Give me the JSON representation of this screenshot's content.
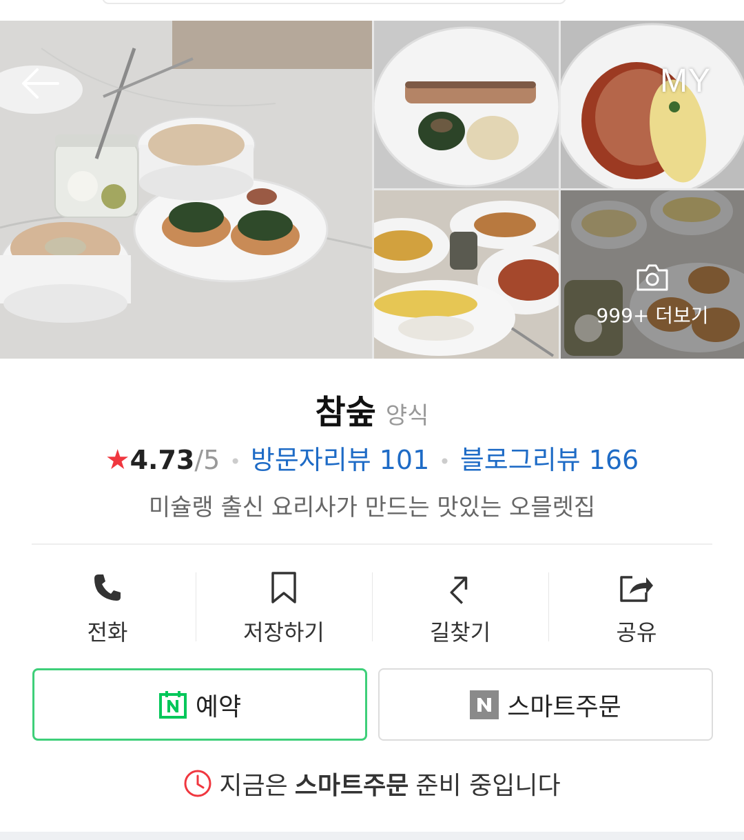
{
  "header": {
    "back_icon": "arrow-left-icon",
    "my_label": "MY"
  },
  "gallery": {
    "more_label": "999+ 더보기",
    "camera_icon": "camera-icon"
  },
  "place": {
    "name": "참숲",
    "category": "양식",
    "rating": "4.73",
    "rating_max": "/5",
    "visitor_reviews": "방문자리뷰 101",
    "blog_reviews": "블로그리뷰 166",
    "description": "미슐랭 출신 요리사가 만드는 맛있는 오믈렛집"
  },
  "actions": [
    {
      "label": "전화",
      "icon": "phone-icon"
    },
    {
      "label": "저장하기",
      "icon": "bookmark-icon"
    },
    {
      "label": "길찾기",
      "icon": "directions-icon"
    },
    {
      "label": "공유",
      "icon": "share-icon"
    }
  ],
  "buttons": {
    "reserve_label": "예약",
    "order_label": "스마트주문"
  },
  "notice": {
    "prefix": "지금은",
    "highlight": "스마트주문",
    "suffix": "준비 중입니다"
  },
  "colors": {
    "star": "#f0373f",
    "link": "#1e6bc6",
    "reserve_border": "#3ecf79",
    "naver_green": "#03c75a"
  }
}
